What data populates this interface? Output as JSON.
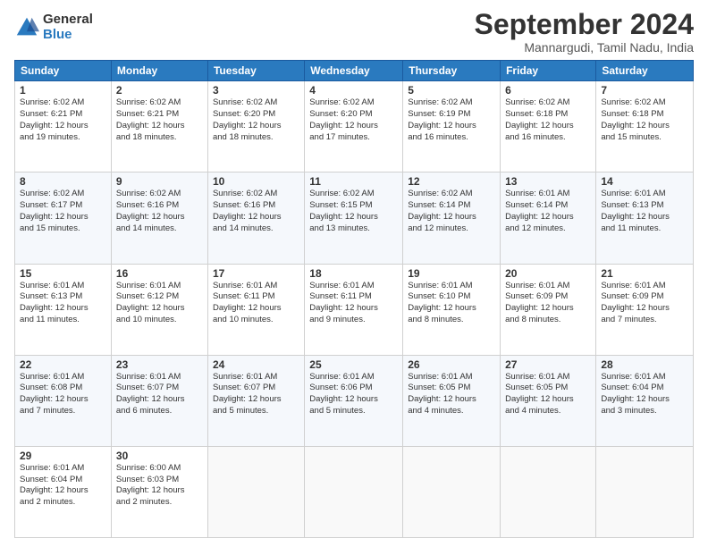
{
  "logo": {
    "general": "General",
    "blue": "Blue"
  },
  "title": "September 2024",
  "location": "Mannargudi, Tamil Nadu, India",
  "headers": [
    "Sunday",
    "Monday",
    "Tuesday",
    "Wednesday",
    "Thursday",
    "Friday",
    "Saturday"
  ],
  "weeks": [
    [
      {
        "day": "1",
        "info": "Sunrise: 6:02 AM\nSunset: 6:21 PM\nDaylight: 12 hours\nand 19 minutes."
      },
      {
        "day": "2",
        "info": "Sunrise: 6:02 AM\nSunset: 6:21 PM\nDaylight: 12 hours\nand 18 minutes."
      },
      {
        "day": "3",
        "info": "Sunrise: 6:02 AM\nSunset: 6:20 PM\nDaylight: 12 hours\nand 18 minutes."
      },
      {
        "day": "4",
        "info": "Sunrise: 6:02 AM\nSunset: 6:20 PM\nDaylight: 12 hours\nand 17 minutes."
      },
      {
        "day": "5",
        "info": "Sunrise: 6:02 AM\nSunset: 6:19 PM\nDaylight: 12 hours\nand 16 minutes."
      },
      {
        "day": "6",
        "info": "Sunrise: 6:02 AM\nSunset: 6:18 PM\nDaylight: 12 hours\nand 16 minutes."
      },
      {
        "day": "7",
        "info": "Sunrise: 6:02 AM\nSunset: 6:18 PM\nDaylight: 12 hours\nand 15 minutes."
      }
    ],
    [
      {
        "day": "8",
        "info": "Sunrise: 6:02 AM\nSunset: 6:17 PM\nDaylight: 12 hours\nand 15 minutes."
      },
      {
        "day": "9",
        "info": "Sunrise: 6:02 AM\nSunset: 6:16 PM\nDaylight: 12 hours\nand 14 minutes."
      },
      {
        "day": "10",
        "info": "Sunrise: 6:02 AM\nSunset: 6:16 PM\nDaylight: 12 hours\nand 14 minutes."
      },
      {
        "day": "11",
        "info": "Sunrise: 6:02 AM\nSunset: 6:15 PM\nDaylight: 12 hours\nand 13 minutes."
      },
      {
        "day": "12",
        "info": "Sunrise: 6:02 AM\nSunset: 6:14 PM\nDaylight: 12 hours\nand 12 minutes."
      },
      {
        "day": "13",
        "info": "Sunrise: 6:01 AM\nSunset: 6:14 PM\nDaylight: 12 hours\nand 12 minutes."
      },
      {
        "day": "14",
        "info": "Sunrise: 6:01 AM\nSunset: 6:13 PM\nDaylight: 12 hours\nand 11 minutes."
      }
    ],
    [
      {
        "day": "15",
        "info": "Sunrise: 6:01 AM\nSunset: 6:13 PM\nDaylight: 12 hours\nand 11 minutes."
      },
      {
        "day": "16",
        "info": "Sunrise: 6:01 AM\nSunset: 6:12 PM\nDaylight: 12 hours\nand 10 minutes."
      },
      {
        "day": "17",
        "info": "Sunrise: 6:01 AM\nSunset: 6:11 PM\nDaylight: 12 hours\nand 10 minutes."
      },
      {
        "day": "18",
        "info": "Sunrise: 6:01 AM\nSunset: 6:11 PM\nDaylight: 12 hours\nand 9 minutes."
      },
      {
        "day": "19",
        "info": "Sunrise: 6:01 AM\nSunset: 6:10 PM\nDaylight: 12 hours\nand 8 minutes."
      },
      {
        "day": "20",
        "info": "Sunrise: 6:01 AM\nSunset: 6:09 PM\nDaylight: 12 hours\nand 8 minutes."
      },
      {
        "day": "21",
        "info": "Sunrise: 6:01 AM\nSunset: 6:09 PM\nDaylight: 12 hours\nand 7 minutes."
      }
    ],
    [
      {
        "day": "22",
        "info": "Sunrise: 6:01 AM\nSunset: 6:08 PM\nDaylight: 12 hours\nand 7 minutes."
      },
      {
        "day": "23",
        "info": "Sunrise: 6:01 AM\nSunset: 6:07 PM\nDaylight: 12 hours\nand 6 minutes."
      },
      {
        "day": "24",
        "info": "Sunrise: 6:01 AM\nSunset: 6:07 PM\nDaylight: 12 hours\nand 5 minutes."
      },
      {
        "day": "25",
        "info": "Sunrise: 6:01 AM\nSunset: 6:06 PM\nDaylight: 12 hours\nand 5 minutes."
      },
      {
        "day": "26",
        "info": "Sunrise: 6:01 AM\nSunset: 6:05 PM\nDaylight: 12 hours\nand 4 minutes."
      },
      {
        "day": "27",
        "info": "Sunrise: 6:01 AM\nSunset: 6:05 PM\nDaylight: 12 hours\nand 4 minutes."
      },
      {
        "day": "28",
        "info": "Sunrise: 6:01 AM\nSunset: 6:04 PM\nDaylight: 12 hours\nand 3 minutes."
      }
    ],
    [
      {
        "day": "29",
        "info": "Sunrise: 6:01 AM\nSunset: 6:04 PM\nDaylight: 12 hours\nand 2 minutes."
      },
      {
        "day": "30",
        "info": "Sunrise: 6:00 AM\nSunset: 6:03 PM\nDaylight: 12 hours\nand 2 minutes."
      },
      {
        "day": "",
        "info": ""
      },
      {
        "day": "",
        "info": ""
      },
      {
        "day": "",
        "info": ""
      },
      {
        "day": "",
        "info": ""
      },
      {
        "day": "",
        "info": ""
      }
    ]
  ]
}
